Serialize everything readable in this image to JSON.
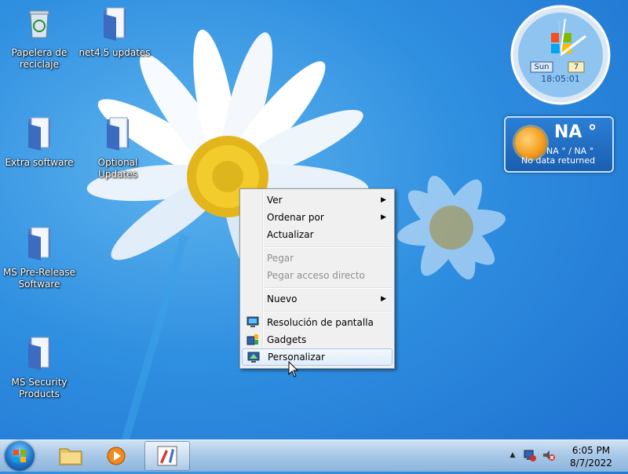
{
  "desktop": {
    "icons": [
      {
        "label": "Papelera de reciclaje",
        "icon": "recycle-bin-icon"
      },
      {
        "label": "net4.5 updates",
        "icon": "folder-icon"
      },
      {
        "label": "Extra software",
        "icon": "folder-icon"
      },
      {
        "label": "Optional Updates",
        "icon": "folder-icon"
      },
      {
        "label": "MS Pre-Release Software",
        "icon": "folder-icon"
      },
      {
        "label": "MS Security Products",
        "icon": "folder-icon"
      }
    ]
  },
  "gadgets": {
    "clock": {
      "day": "Sun",
      "date": "7",
      "time": "18:05:01"
    },
    "weather": {
      "temp": "NA °",
      "range": "NA ° / NA °",
      "message": "No data returned"
    }
  },
  "context_menu": {
    "items": [
      {
        "label": "Ver",
        "submenu": true,
        "enabled": true
      },
      {
        "label": "Ordenar por",
        "submenu": true,
        "enabled": true
      },
      {
        "label": "Actualizar",
        "submenu": false,
        "enabled": true
      },
      {
        "label": "Pegar",
        "submenu": false,
        "enabled": false
      },
      {
        "label": "Pegar acceso directo",
        "submenu": false,
        "enabled": false
      },
      {
        "label": "Nuevo",
        "submenu": true,
        "enabled": true
      },
      {
        "label": "Resolución de pantalla",
        "submenu": false,
        "enabled": true,
        "icon": "display-icon"
      },
      {
        "label": "Gadgets",
        "submenu": false,
        "enabled": true,
        "icon": "gadgets-icon"
      },
      {
        "label": "Personalizar",
        "submenu": false,
        "enabled": true,
        "icon": "personalize-icon",
        "highlighted": true
      }
    ],
    "submenu_arrow": "▶"
  },
  "taskbar": {
    "pinned": [
      {
        "icon": "file-explorer-icon"
      },
      {
        "icon": "media-player-icon"
      },
      {
        "icon": "paint-app-icon",
        "active": true
      }
    ],
    "tray": {
      "time": "6:05 PM",
      "date": "8/7/2022",
      "show_hidden": "▲"
    }
  },
  "colors": {
    "desktop_blue": "#2f8fe0",
    "menu_bg": "#f0f0f0",
    "menu_hover": "#e1edfa",
    "disabled_text": "#8e8e8e"
  }
}
